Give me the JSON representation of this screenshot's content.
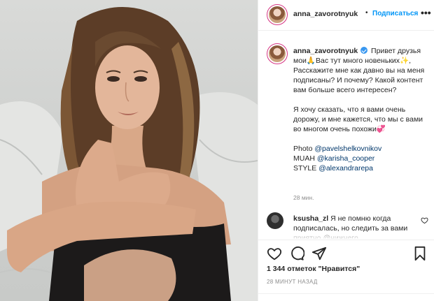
{
  "header": {
    "username": "anna_zavorotnyuk",
    "separator": "•",
    "follow_label": "Подписаться",
    "more_glyph": "•••"
  },
  "caption": {
    "username": "anna_zavorotnyuk",
    "line1": "Привет друзья мои🙏Вас тут много новеньких✨, Расскажите мне как давно вы на меня подписаны? И почему? Какой контент вам больше всего интересен?",
    "line2": "Я хочу сказать, что я вами очень дорожу, и мне кажется, что мы с вами во многом очень похожи💞",
    "credits": [
      {
        "label": "Photo",
        "handle": "@pavelshelkovnikov"
      },
      {
        "label": "MUAH",
        "handle": "@karisha_cooper"
      },
      {
        "label": "STYLE",
        "handle": "@alexandrarepa"
      }
    ],
    "time": "28 мин."
  },
  "comment": {
    "username": "ksusha_zl",
    "text": "Я не помню когда подписалась, но следить за вами приятно @нижнего"
  },
  "actions": {
    "like_icon": "heart-icon",
    "comment_icon": "comment-icon",
    "share_icon": "share-icon",
    "save_icon": "bookmark-icon"
  },
  "likes": "1 344 отметок \"Нравится\"",
  "post_time": "28 МИНУТ НАЗАД",
  "colors": {
    "link": "#00376b",
    "follow": "#0095f6",
    "verified": "#3897f0",
    "muted": "#8e8e8e"
  }
}
